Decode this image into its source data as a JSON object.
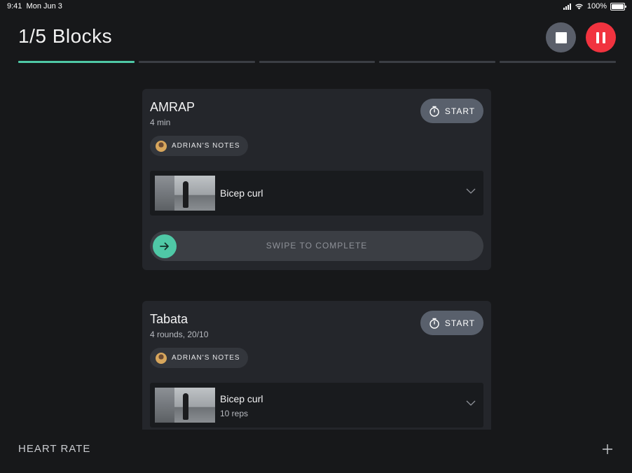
{
  "status_bar": {
    "time": "9:41",
    "date": "Mon Jun 3",
    "battery": "100%"
  },
  "header": {
    "title": "1/5 Blocks",
    "total_blocks": 5,
    "current_block": 1
  },
  "icons": {
    "stop": "stop-icon",
    "pause": "pause-icon",
    "timer": "timer-icon",
    "chevron": "chevron-down-icon",
    "arrow": "arrow-right-icon",
    "add": "plus-icon"
  },
  "colors": {
    "accent": "#4fc8a6",
    "pause": "#f1333f",
    "stop": "#5a5f6a",
    "card": "#24262b",
    "background": "#17181a"
  },
  "blocks": [
    {
      "title": "AMRAP",
      "subtitle": "4 min",
      "start_label": "START",
      "notes_label": "ADRIAN'S NOTES",
      "exercise": {
        "name": "Bicep curl",
        "reps": ""
      },
      "swipe_label": "SWIPE TO COMPLETE"
    },
    {
      "title": "Tabata",
      "subtitle": "4 rounds, 20/10",
      "start_label": "START",
      "notes_label": "ADRIAN'S NOTES",
      "exercise": {
        "name": "Bicep curl",
        "reps": "10 reps"
      }
    }
  ],
  "footer": {
    "heart_rate_label": "HEART RATE"
  }
}
